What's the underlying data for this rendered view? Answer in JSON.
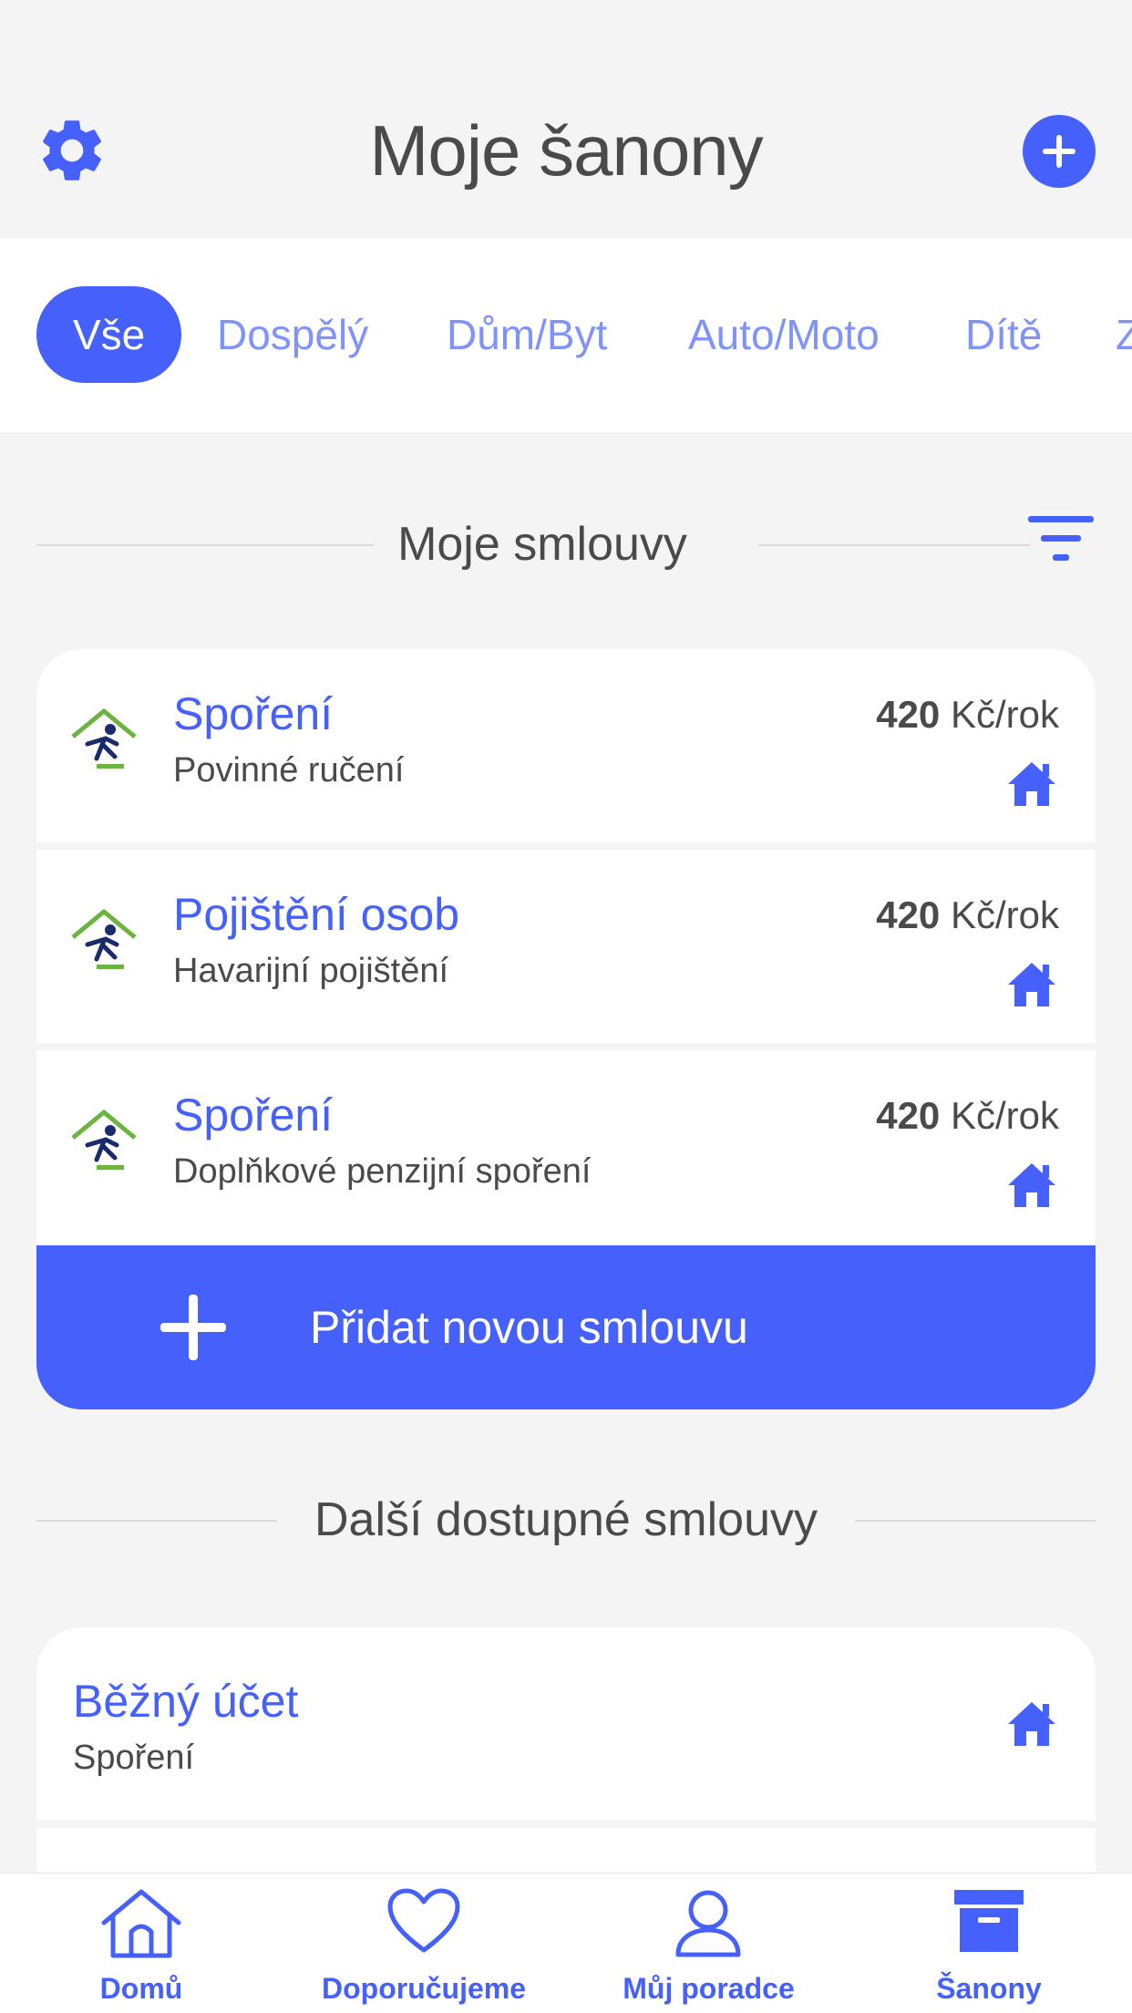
{
  "header": {
    "title": "Moje šanony",
    "settings_icon": "gear-icon",
    "add_icon": "plus-circle-icon"
  },
  "tabs": [
    {
      "label": "Vše",
      "active": true
    },
    {
      "label": "Dospělý",
      "active": false
    },
    {
      "label": "Dům/Byt",
      "active": false
    },
    {
      "label": "Auto/Moto",
      "active": false
    },
    {
      "label": "Dítě",
      "active": false
    },
    {
      "label": "Z",
      "active": false
    }
  ],
  "my_contracts": {
    "heading": "Moje smlouvy",
    "filter_icon": "filter-icon",
    "items": [
      {
        "title": "Spoření",
        "subtitle": "Povinné ručení",
        "amount": "420",
        "unit": " Kč/rok",
        "icon": "home-icon"
      },
      {
        "title": "Pojištění osob",
        "subtitle": "Havarijní pojištění",
        "amount": "420",
        "unit": " Kč/rok",
        "icon": "home-icon"
      },
      {
        "title": "Spoření",
        "subtitle": "Doplňkové penzijní spoření",
        "amount": "420",
        "unit": " Kč/rok",
        "icon": "home-icon"
      }
    ],
    "add_button": "Přidat novou smlouvu"
  },
  "available_contracts": {
    "heading": "Další dostupné smlouvy",
    "items": [
      {
        "title": "Běžný účet",
        "subtitle": "Spoření",
        "icon": "home-icon"
      }
    ]
  },
  "bottom_nav": [
    {
      "label": "Domů",
      "icon": "home-outline-icon"
    },
    {
      "label": "Doporučujeme",
      "icon": "heart-icon"
    },
    {
      "label": "Můj poradce",
      "icon": "person-icon"
    },
    {
      "label": "Šanony",
      "icon": "archive-box-icon",
      "active": true
    }
  ],
  "colors": {
    "accent": "#4560fb",
    "tab_inactive": "#7f93fb",
    "background": "#f4f4f5",
    "text": "#4a4a4a",
    "logo_green": "#6cb33f",
    "logo_navy": "#1b2a6b"
  }
}
